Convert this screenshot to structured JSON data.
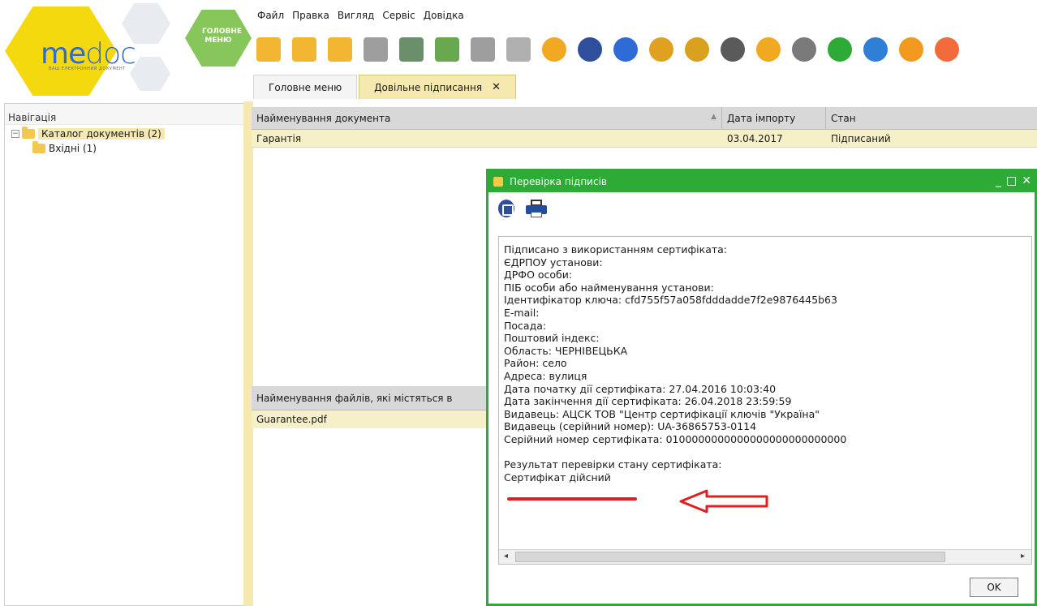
{
  "app": {
    "logo_me": "me",
    "logo_doc": "doc",
    "logo_sub": "ВАШ ЕЛЕКТРОННИЙ ДОКУМЕНТ",
    "main_menu_button": "ГОЛОВНЕ МЕНЮ"
  },
  "menubar": [
    "Файл",
    "Правка",
    "Вигляд",
    "Сервіс",
    "Довідка"
  ],
  "toolbar_icons": [
    "new-doc-icon",
    "open-folder-icon",
    "delete-doc-icon",
    "copy-icon",
    "export-icon",
    "add-doc-icon",
    "preview-icon",
    "remove-doc-icon",
    "send-envelope-icon",
    "sign-shield-icon",
    "keys-icon",
    "cert-red-icon",
    "lock-doc-icon",
    "print-icon",
    "receive-envelope-icon",
    "gear-icon",
    "check-green-icon",
    "check-blue-icon",
    "help-icon",
    "chat-icon"
  ],
  "tabs": [
    {
      "label": "Головне меню",
      "active": false
    },
    {
      "label": "Довільне підписання",
      "active": true,
      "close": "✕"
    }
  ],
  "nav": {
    "title": "Навігація",
    "tree": [
      {
        "label": "Каталог документів  (2)",
        "level": 0,
        "selected": true
      },
      {
        "label": "Вхідні  (1)",
        "level": 1,
        "selected": false
      }
    ]
  },
  "documents_table": {
    "columns": [
      "Найменування документа",
      "Дата імпорту",
      "Стан"
    ],
    "rows": [
      [
        "Гарантія",
        "03.04.2017",
        "Підписаний"
      ]
    ]
  },
  "files_table": {
    "header": "Найменування файлів, які містяться в",
    "rows": [
      "Guarantee.pdf"
    ]
  },
  "dialog": {
    "title": "Перевірка підписів",
    "controls": [
      "_",
      "□",
      "✕"
    ],
    "lines": [
      "Підписано з використанням сертифіката:",
      "ЄДРПОУ установи:",
      "ДРФО особи:",
      "ПІБ особи або найменування установи:",
      "Ідентифікатор ключа: cfd755f57a058fdddadde7f2e9876445b63",
      "E-mail:",
      "Посада:",
      "Поштовий індекс:",
      "Область: ЧЕРНІВЕЦЬКА",
      "Район: село",
      "Адреса: вулиця",
      "Дата початку дії сертифіката: 27.04.2016 10:03:40",
      "Дата закінчення дії сертифіката: 26.04.2018 23:59:59",
      "Видавець: АЦСК ТОВ \"Центр сертифікації ключів \"Україна\"",
      "Видавець (серійний номер): UA-36865753-0114",
      "Серійний номер сертифіката: 0100000000000000000000000000",
      "",
      "Результат перевірки стану сертифіката:",
      "Сертифікат дійсний"
    ],
    "ok_label": "OK"
  },
  "colors": {
    "accent_green": "#2eaa36",
    "selection_yellow": "#f6f0c8",
    "logo_yellow": "#f5d90f",
    "annotation_red": "#e02020"
  }
}
